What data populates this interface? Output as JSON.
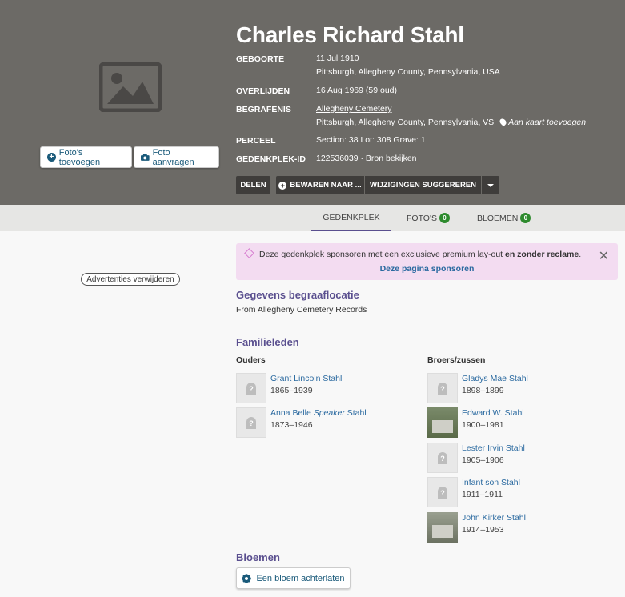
{
  "memorial": {
    "name": "Charles Richard Stahl",
    "facts": {
      "birth_label": "GEBOORTE",
      "birth_date": "11 Jul 1910",
      "birth_place": "Pittsburgh, Allegheny County, Pennsylvania, USA",
      "death_label": "OVERLIJDEN",
      "death_date": "16 Aug 1969 (59 oud)",
      "burial_label": "BEGRAFENIS",
      "burial_cemetery": "Allegheny Cemetery",
      "burial_place": "Pittsburgh, Allegheny County, Pennsylvania, VS",
      "add_to_map": "Aan kaart toevoegen",
      "plot_label": "PERCEEL",
      "plot_value": "Section: 38 Lot: 308 Grave: 1",
      "memorial_id_label": "GEDENKPLEK-ID",
      "memorial_id": "122536039 ·",
      "view_source": "Bron bekijken"
    }
  },
  "photo_buttons": {
    "add_photos": "Foto's toevoegen",
    "request_photo": "Foto aanvragen"
  },
  "actions": {
    "share": "DELEN",
    "save_to": "BEWAREN NAAR ...",
    "suggest_edits": "WIJZIGINGEN SUGGEREREN"
  },
  "tabs": {
    "memorial": "GEDENKPLEK",
    "photos": "FOTO'S",
    "photos_count": "0",
    "flowers": "BLOEMEN",
    "flowers_count": "0"
  },
  "ads": {
    "remove_ads": "Advertenties verwijderen"
  },
  "sponsor": {
    "text_part1": "Deze gedenkplek sponsoren met een exclusieve premium lay-out ",
    "text_bold": "en zonder reclame",
    "text_part2": ".",
    "link": "Deze pagina sponsoren",
    "close": "✕"
  },
  "burial_details": {
    "title": "Gegevens begraaflocatie",
    "text": "From Allegheny Cemetery Records"
  },
  "family": {
    "title": "Familieleden",
    "parents_title": "Ouders",
    "siblings_title": "Broers/zussen",
    "parents": [
      {
        "name": "Grant Lincoln Stahl",
        "dates": "1865–1939"
      },
      {
        "name_pre": "Anna Belle ",
        "name_nick": "Speaker",
        "name_post": " Stahl",
        "dates": "1873–1946"
      }
    ],
    "siblings": [
      {
        "name": "Gladys Mae Stahl",
        "dates": "1898–1899"
      },
      {
        "name": "Edward W. Stahl",
        "dates": "1900–1981"
      },
      {
        "name": "Lester Irvin Stahl",
        "dates": "1905–1906"
      },
      {
        "name": "Infant son Stahl",
        "dates": "1911–1911"
      },
      {
        "name": "John Kirker Stahl",
        "dates": "1914–1953"
      }
    ]
  },
  "flowers": {
    "title": "Bloemen",
    "leave_flower": "Een bloem achterlaten"
  }
}
